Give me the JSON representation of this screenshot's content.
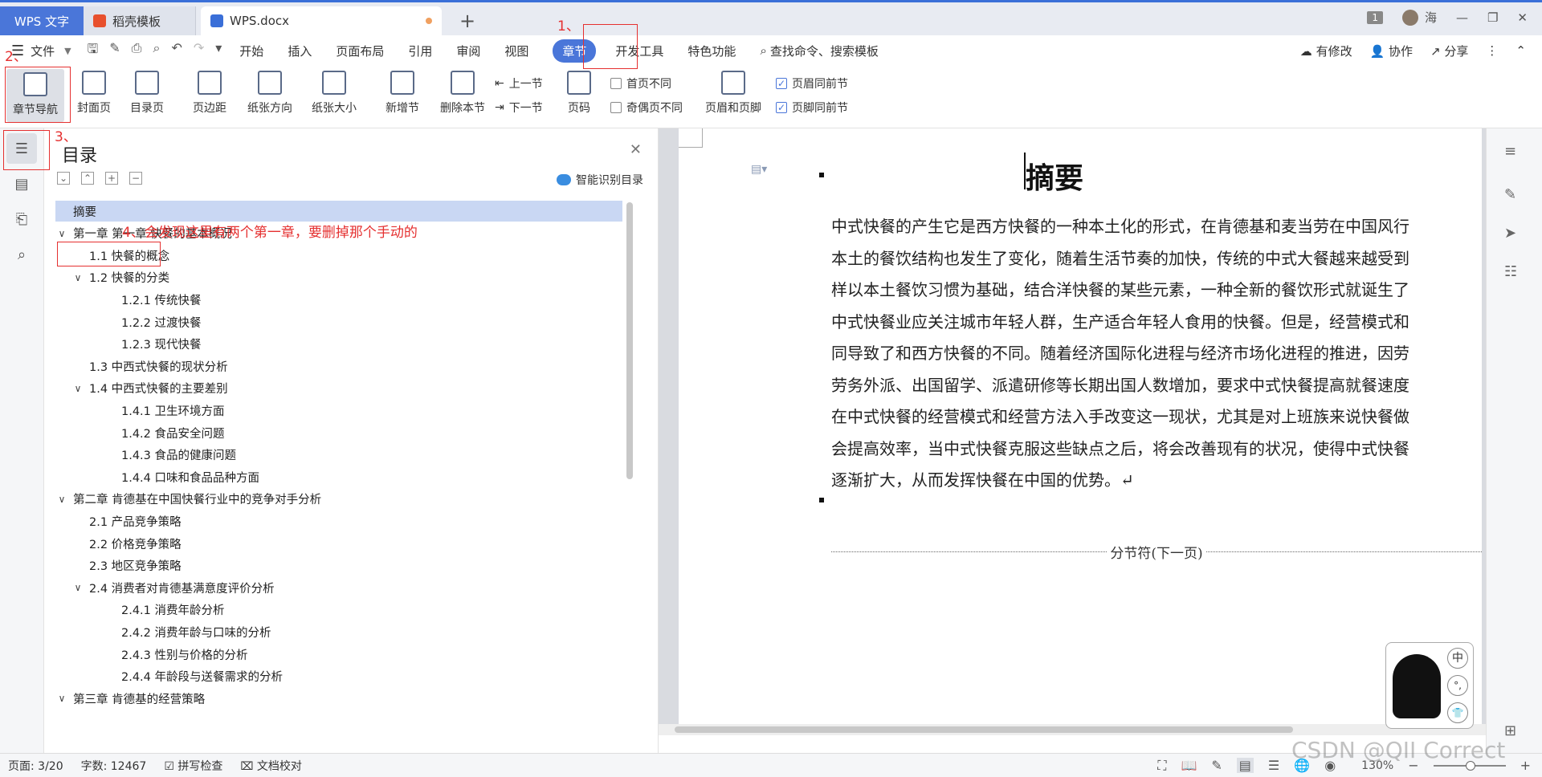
{
  "tabs": {
    "wps": "WPS 文字",
    "daoke": "稻壳模板",
    "doc": "WPS.docx",
    "plus": "+"
  },
  "window": {
    "badge": "1",
    "user": "海",
    "minimize": "—",
    "restore": "❐",
    "close": "✕"
  },
  "menu": {
    "file": "文件",
    "items": [
      "开始",
      "插入",
      "页面布局",
      "引用",
      "审阅",
      "视图",
      "章节",
      "开发工具",
      "特色功能"
    ],
    "active": "章节",
    "search": "查找命令、搜索模板",
    "has_changes": "有修改",
    "collab": "协作",
    "share": "分享"
  },
  "ribbon": {
    "chapter_nav": "章节导航",
    "cover": "封面页",
    "toc": "目录页",
    "margin": "页边距",
    "orientation": "纸张方向",
    "size": "纸张大小",
    "new_section": "新增节",
    "delete_section": "删除本节",
    "prev_section": "上一节",
    "next_section": "下一节",
    "page_num": "页码",
    "first_diff": "首页不同",
    "odd_even_diff": "奇偶页不同",
    "header_footer": "页眉和页脚",
    "header_same": "页眉同前节",
    "footer_same": "页脚同前节"
  },
  "annotations": {
    "a1": "1、",
    "a2": "2、",
    "a3": "3、",
    "a4": "4、会发现这里有两个第一章，要删掉那个手动的"
  },
  "nav": {
    "title": "目录",
    "smart_toc": "智能识别目录"
  },
  "toc": [
    {
      "text": "摘要",
      "level": 0,
      "chev": "",
      "selected": true
    },
    {
      "text": "第一章  第一章  快餐的基本概况",
      "level": 0,
      "chev": "∨"
    },
    {
      "text": "1.1  快餐的概念",
      "level": 1,
      "chev": ""
    },
    {
      "text": "1.2  快餐的分类",
      "level": 1,
      "chev": "∨"
    },
    {
      "text": "1.2.1  传统快餐",
      "level": 2,
      "chev": ""
    },
    {
      "text": "1.2.2  过渡快餐",
      "level": 2,
      "chev": ""
    },
    {
      "text": "1.2.3  现代快餐",
      "level": 2,
      "chev": ""
    },
    {
      "text": "1.3  中西式快餐的现状分析",
      "level": 1,
      "chev": ""
    },
    {
      "text": "1.4  中西式快餐的主要差别",
      "level": 1,
      "chev": "∨"
    },
    {
      "text": "1.4.1  卫生环境方面",
      "level": 2,
      "chev": ""
    },
    {
      "text": "1.4.2  食品安全问题",
      "level": 2,
      "chev": ""
    },
    {
      "text": "1.4.3  食品的健康问题",
      "level": 2,
      "chev": ""
    },
    {
      "text": "1.4.4  口味和食品品种方面",
      "level": 2,
      "chev": ""
    },
    {
      "text": "第二章  肯德基在中国快餐行业中的竞争对手分析",
      "level": 0,
      "chev": "∨"
    },
    {
      "text": "2.1  产品竞争策略",
      "level": 1,
      "chev": ""
    },
    {
      "text": "2.2  价格竞争策略",
      "level": 1,
      "chev": ""
    },
    {
      "text": "2.3  地区竞争策略",
      "level": 1,
      "chev": ""
    },
    {
      "text": "2.4  消费者对肯德基满意度评价分析",
      "level": 1,
      "chev": "∨"
    },
    {
      "text": "2.4.1  消费年龄分析",
      "level": 2,
      "chev": ""
    },
    {
      "text": "2.4.2  消费年龄与口味的分析",
      "level": 2,
      "chev": ""
    },
    {
      "text": "2.4.3  性别与价格的分析",
      "level": 2,
      "chev": ""
    },
    {
      "text": "2.4.4  年龄段与送餐需求的分析",
      "level": 2,
      "chev": ""
    },
    {
      "text": "第三章  肯德基的经营策略",
      "level": 0,
      "chev": "∨"
    }
  ],
  "doc": {
    "title": "摘要",
    "paragraph_lines": [
      "中式快餐的产生它是西方快餐的一种本土化的形式，在肯德基和麦当劳在中国风行",
      "本土的餐饮结构也发生了变化，随着生活节奏的加快，传统的中式大餐越来越受到",
      "样以本土餐饮习惯为基础，结合洋快餐的某些元素，一种全新的餐饮形式就诞生了",
      "中式快餐业应关注城市年轻人群，生产适合年轻人食用的快餐。但是，经营模式和",
      "同导致了和西方快餐的不同。随着经济国际化进程与经济市场化进程的推进，因劳",
      "劳务外派、出国留学、派遣研修等长期出国人数增加，要求中式快餐提高就餐速度",
      "在中式快餐的经营模式和经营方法入手改变这一现状，尤其是对上班族来说快餐做",
      "会提高效率，当中式快餐克服这些缺点之后，将会改善现有的状况，使得中式快餐",
      "逐渐扩大，从而发挥快餐在中国的优势。↵"
    ],
    "section_break": "分节符(下一页)"
  },
  "ime": {
    "lang": "中",
    "punct": "°,",
    "skin": "👕"
  },
  "status": {
    "page": "页面: 3/20",
    "words": "字数: 12467",
    "spell": "拼写检查",
    "proof": "文档校对",
    "zoom": "130%",
    "watermark": "CSDN @QII Correct"
  },
  "colors": {
    "accent": "#4a76d9",
    "annotation": "#e53030",
    "toc_selected": "#c9d7f3"
  }
}
